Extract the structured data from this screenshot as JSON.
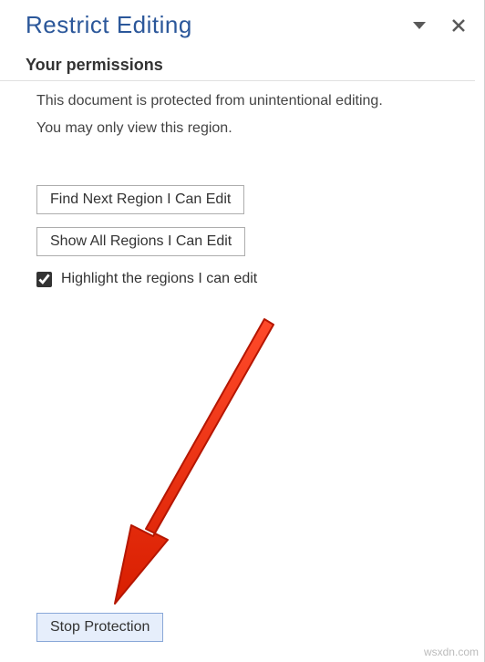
{
  "pane": {
    "title": "Restrict Editing"
  },
  "section": {
    "heading": "Your permissions",
    "line1": "This document is protected from unintentional editing.",
    "line2": "You may only view this region."
  },
  "buttons": {
    "find_next": "Find Next Region I Can Edit",
    "show_all": "Show All Regions I Can Edit"
  },
  "checkbox": {
    "highlight_label": "Highlight the regions I can edit",
    "highlight_checked": true
  },
  "footer": {
    "stop_protection": "Stop Protection"
  },
  "watermark": "wsxdn.com"
}
